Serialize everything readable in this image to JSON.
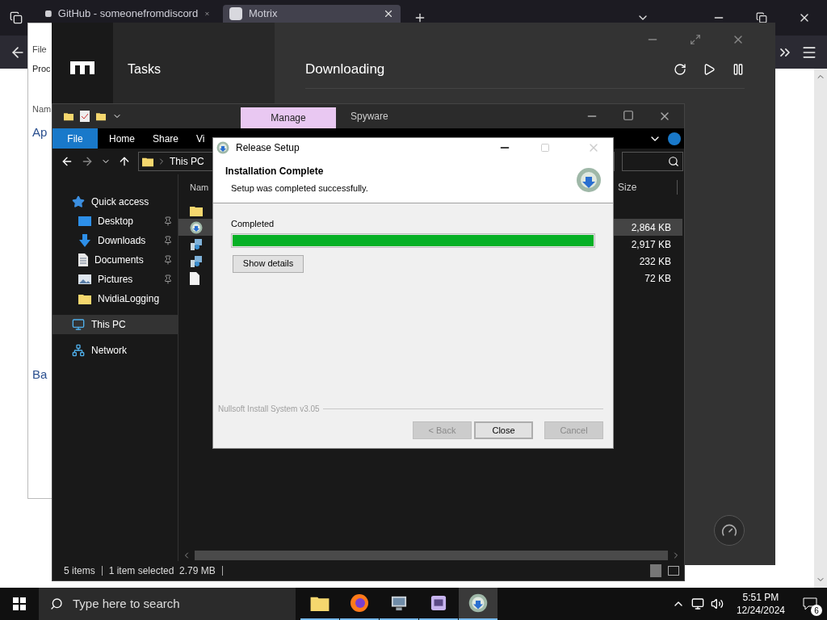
{
  "browser": {
    "tabs": [
      {
        "title": "GitHub - someonefromdiscord",
        "selected": false
      },
      {
        "title": "Motrix",
        "selected": true
      }
    ]
  },
  "back_window": {
    "menu_item": "File",
    "row_label": "Proc",
    "column_header": "Nam",
    "sections": [
      "Ap",
      "Ba"
    ]
  },
  "motrix": {
    "sidebar_title": "Tasks",
    "heading": "Downloading"
  },
  "explorer": {
    "context_tab": "Manage",
    "title": "Spyware",
    "ribbon_tabs": [
      {
        "label": "File",
        "selected": true
      },
      {
        "label": "Home",
        "selected": false
      },
      {
        "label": "Share",
        "selected": false
      },
      {
        "label": "Vi",
        "selected": false
      }
    ],
    "breadcrumb": "This PC",
    "nav": [
      {
        "label": "Quick access",
        "kind": "star",
        "selected": false,
        "children": [
          {
            "label": "Desktop",
            "kind": "desktop",
            "pinned": true
          },
          {
            "label": "Downloads",
            "kind": "download",
            "pinned": true
          },
          {
            "label": "Documents",
            "kind": "document",
            "pinned": true
          },
          {
            "label": "Pictures",
            "kind": "picture",
            "pinned": true
          },
          {
            "label": "NvidiaLogging",
            "kind": "folder",
            "pinned": false
          }
        ]
      },
      {
        "label": "This PC",
        "kind": "computer",
        "selected": true
      },
      {
        "label": "Network",
        "kind": "network",
        "selected": false
      }
    ],
    "columns": [
      "Nam",
      "Size"
    ],
    "rows": [
      {
        "kind": "folder",
        "selected": false
      },
      {
        "kind": "setup",
        "size": "2,864 KB",
        "selected": true
      },
      {
        "kind": "installer",
        "size": "2,917 KB",
        "selected": false
      },
      {
        "kind": "installer",
        "size": "232 KB",
        "selected": false
      },
      {
        "kind": "file",
        "size": "72 KB",
        "selected": false
      }
    ],
    "status": [
      "5 items",
      "1 item selected  2.79 MB"
    ]
  },
  "setup": {
    "title": "Release Setup",
    "heading": "Installation Complete",
    "subheading": "Setup was completed successfully.",
    "status": "Completed",
    "level": 1,
    "details_button": "Show details",
    "branding": "Nullsoft Install System v3.05",
    "buttons": [
      {
        "label": "< Back",
        "disabled": true,
        "default": false
      },
      {
        "label": "Close",
        "disabled": false,
        "default": true
      },
      {
        "label": "Cancel",
        "disabled": true,
        "default": false
      }
    ]
  },
  "taskbar": {
    "search_placeholder": "Type here to search",
    "apps": [
      {
        "kind": "folder",
        "selected": false
      },
      {
        "kind": "firefox",
        "selected": false
      },
      {
        "kind": "monitor",
        "selected": false
      },
      {
        "kind": "floppy",
        "selected": false
      },
      {
        "kind": "setup",
        "selected": true
      }
    ],
    "time": "5:51 PM",
    "date": "12/24/2024",
    "notifications": "6"
  }
}
